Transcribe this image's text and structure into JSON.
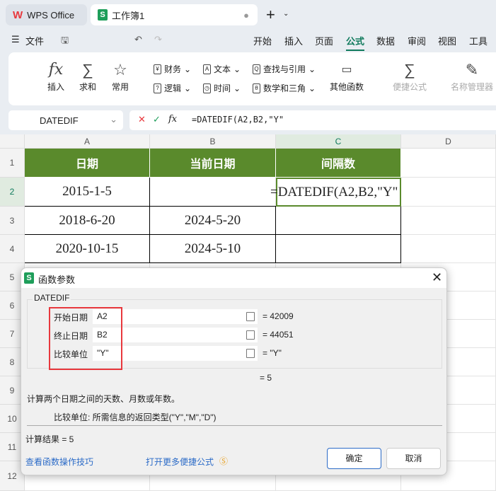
{
  "tabs": {
    "app": "WPS Office",
    "doc": "工作簿1"
  },
  "menu": {
    "file": "文件",
    "items": [
      "开始",
      "插入",
      "页面",
      "公式",
      "数据",
      "审阅",
      "视图",
      "工具"
    ],
    "active": "公式"
  },
  "ribbon": {
    "insert": "插入",
    "sum": "求和",
    "common": "常用",
    "finance": "财务",
    "text": "文本",
    "lookup": "查找与引用",
    "logic": "逻辑",
    "time": "时间",
    "math": "数学和三角",
    "other": "其他函数",
    "quick": "便捷公式",
    "names": "名称管理器"
  },
  "formula_bar": {
    "name_box": "DATEDIF",
    "fx": "fx",
    "formula": "=DATEDIF(A2,B2,\"Y\""
  },
  "sheet": {
    "columns": [
      "A",
      "B",
      "C",
      "D"
    ],
    "rows": [
      "1",
      "2",
      "3",
      "4",
      "5",
      "6",
      "7",
      "8",
      "9",
      "10",
      "11",
      "12"
    ],
    "headers": [
      "日期",
      "当前日期",
      "间隔数"
    ],
    "data": [
      [
        "2015-1-5",
        "",
        "=DATEDIF(A2,B2,\"Y\""
      ],
      [
        "2018-6-20",
        "2024-5-20",
        ""
      ],
      [
        "2020-10-15",
        "2024-5-10",
        ""
      ]
    ]
  },
  "dialog": {
    "title": "函数参数",
    "func": "DATEDIF",
    "args": [
      {
        "label": "开始日期",
        "value": "A2",
        "result": "= 42009"
      },
      {
        "label": "终止日期",
        "value": "B2",
        "result": "= 44051"
      },
      {
        "label": "比较单位",
        "value": "\"Y\"",
        "result": "= \"Y\""
      }
    ],
    "total": "= 5",
    "desc": "计算两个日期之间的天数、月数或年数。",
    "arg_desc": "比较单位:   所需信息的返回类型(\"Y\",\"M\",\"D\")",
    "calc_result": "计算结果  =  5",
    "link1": "查看函数操作技巧",
    "link2": "打开更多便捷公式",
    "ok": "确定",
    "cancel": "取消"
  },
  "colors": {
    "header_green": "#5a8a2c",
    "accent": "#0f7a5c",
    "highlight": "#e8383d"
  }
}
